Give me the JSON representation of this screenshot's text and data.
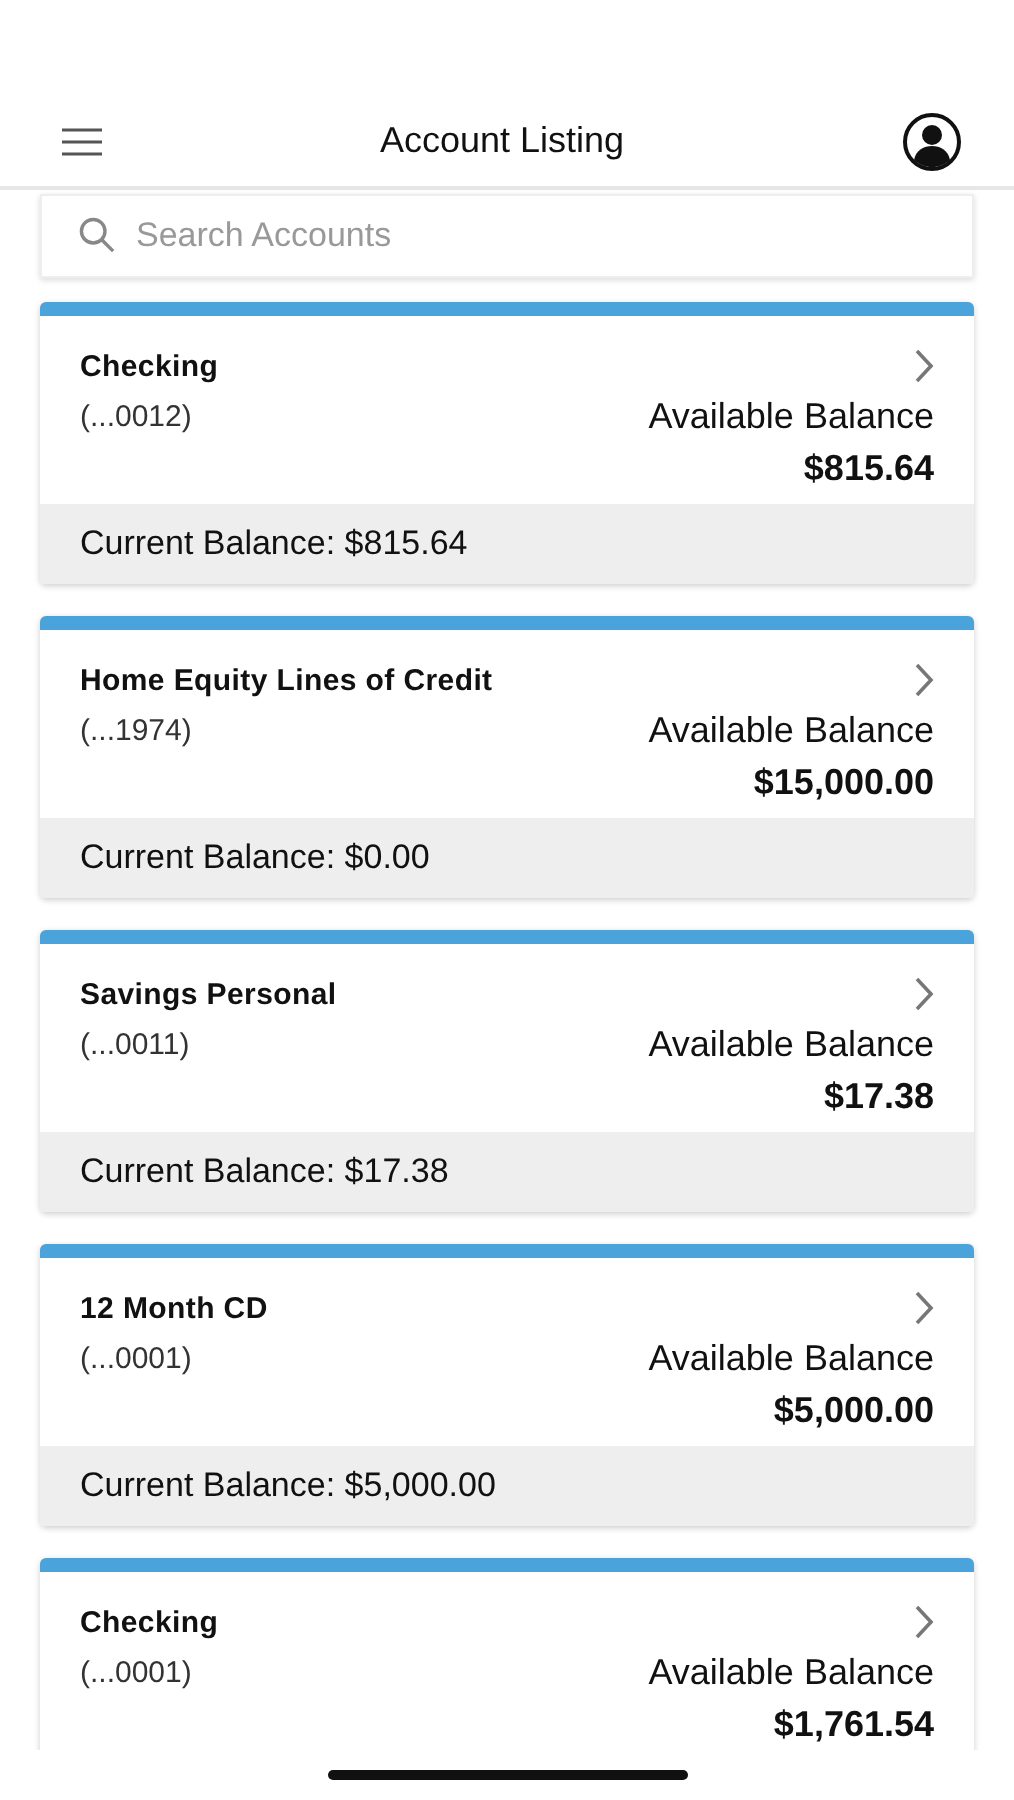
{
  "header": {
    "title": "Account Listing"
  },
  "search": {
    "placeholder": "Search Accounts"
  },
  "accounts": [
    {
      "name": "Checking",
      "number": "(...0012)",
      "available_label": "Available Balance",
      "available": "$815.64",
      "current": "Current Balance: $815.64"
    },
    {
      "name": "Home Equity Lines of Credit",
      "number": "(...1974)",
      "available_label": "Available Balance",
      "available": "$15,000.00",
      "current": "Current Balance: $0.00"
    },
    {
      "name": "Savings Personal",
      "number": "(...0011)",
      "available_label": "Available Balance",
      "available": "$17.38",
      "current": "Current Balance: $17.38"
    },
    {
      "name": "12 Month CD",
      "number": "(...0001)",
      "available_label": "Available Balance",
      "available": "$5,000.00",
      "current": "Current Balance: $5,000.00"
    },
    {
      "name": "Checking",
      "number": "(...0001)",
      "available_label": "Available Balance",
      "available": "$1,761.54"
    }
  ]
}
